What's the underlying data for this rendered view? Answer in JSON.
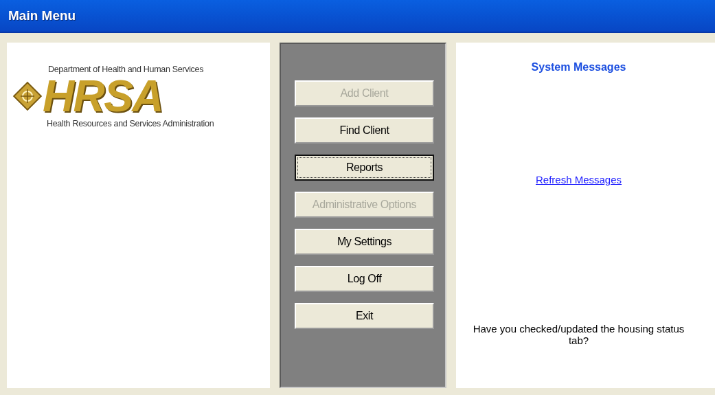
{
  "window": {
    "title": "Main Menu"
  },
  "logo": {
    "top_line": "Department of Health and Human Services",
    "mark": "HRSA",
    "bottom_line": "Health Resources and Services Administration"
  },
  "buttons": [
    {
      "label": "Add Client",
      "disabled": true,
      "focused": false
    },
    {
      "label": "Find Client",
      "disabled": false,
      "focused": false
    },
    {
      "label": "Reports",
      "disabled": false,
      "focused": true
    },
    {
      "label": "Administrative Options",
      "disabled": true,
      "focused": false
    },
    {
      "label": "My Settings",
      "disabled": false,
      "focused": false
    },
    {
      "label": "Log Off",
      "disabled": false,
      "focused": false
    },
    {
      "label": "Exit",
      "disabled": false,
      "focused": false
    }
  ],
  "messages": {
    "title": "System Messages",
    "refresh_link": "Refresh Messages",
    "notice": "Have you checked/updated the housing status tab?"
  }
}
